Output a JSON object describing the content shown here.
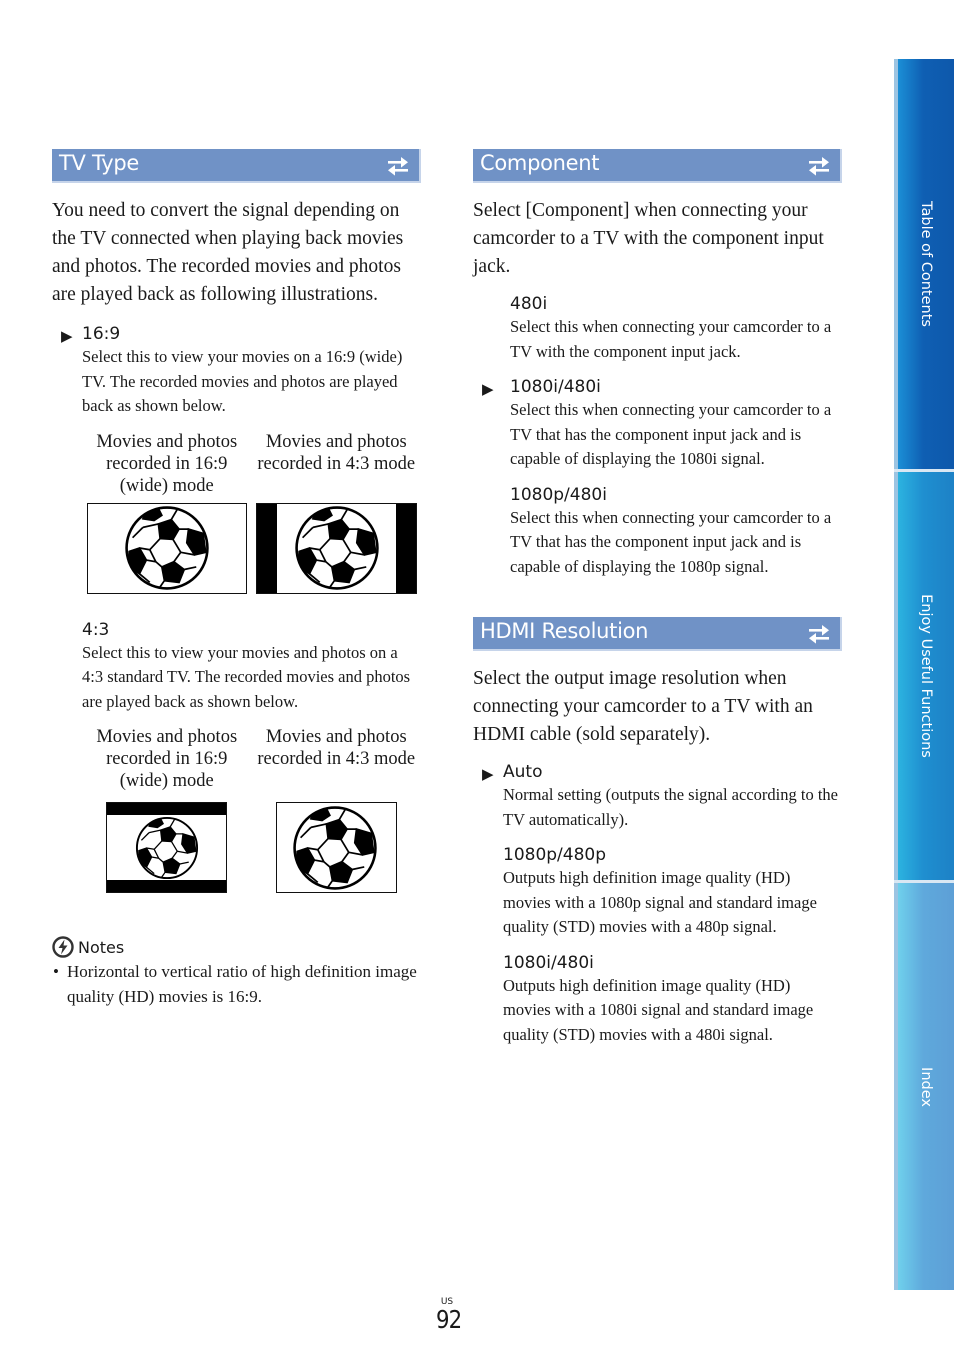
{
  "left": {
    "header": {
      "title": "TV Type",
      "jump_icon": "return-arrows-icon"
    },
    "intro": "You need to convert the signal depending on the TV connected when playing back movies and photos. The recorded movies and photos are played back as following illustrations.",
    "options": [
      {
        "label": "16:9",
        "default": true,
        "desc": "Select this to view your movies on a 16:9 (wide) TV. The recorded movies and photos are played back as shown below.",
        "captions": [
          "Movies and photos recorded in 16:9 (wide) mode",
          "Movies and photos recorded in 4:3 mode"
        ]
      },
      {
        "label": "4:3",
        "default": false,
        "desc": "Select this to view your movies and photos on a 4:3 standard TV. The recorded movies and photos are played back as shown below.",
        "captions": [
          "Movies and photos recorded in 16:9 (wide) mode",
          "Movies and photos recorded in 4:3 mode"
        ]
      }
    ],
    "notes": {
      "title": "Notes",
      "items": [
        "Horizontal to vertical ratio of high definition image quality (HD) movies is 16:9."
      ]
    }
  },
  "right": {
    "component": {
      "header": {
        "title": "Component",
        "jump_icon": "return-arrows-icon"
      },
      "intro": "Select [Component] when connecting your camcorder to a TV with the component input jack.",
      "options": [
        {
          "label": "480i",
          "default": false,
          "desc": "Select this when connecting your camcorder to a TV with the component input jack."
        },
        {
          "label": "1080i/480i",
          "default": true,
          "desc": "Select this when connecting your camcorder to a TV that has the component input jack and is capable of displaying the 1080i signal."
        },
        {
          "label": "1080p/480i",
          "default": false,
          "desc": "Select this when connecting your camcorder to a TV that has the component input jack and is capable of displaying the 1080p signal."
        }
      ]
    },
    "hdmi": {
      "header": {
        "title": "HDMI Resolution",
        "jump_icon": "return-arrows-icon"
      },
      "intro": "Select the output image resolution when connecting your camcorder to a TV with an HDMI cable (sold separately).",
      "options": [
        {
          "label": "Auto",
          "default": true,
          "desc": "Normal setting (outputs the signal according to the TV automatically)."
        },
        {
          "label": "1080p/480p",
          "default": false,
          "desc": "Outputs high definition image quality (HD) movies with a 1080p signal and standard image quality (STD) movies with a 480p signal."
        },
        {
          "label": "1080i/480i",
          "default": false,
          "desc": "Outputs high definition image quality (HD) movies with a 1080i signal and standard image quality (STD) movies with a 480i signal."
        }
      ]
    }
  },
  "default_marker": "▶",
  "bullet": "•",
  "side_tabs": [
    "Table of Contents",
    "Enjoy Useful Functions",
    "Index"
  ],
  "page": {
    "region": "US",
    "number": "92"
  },
  "colors": {
    "header_bg": "#7092c6",
    "tab_toc": "#0f5fb3",
    "tab_functions": "#1f8fd0",
    "tab_index": "#5fa9dc"
  }
}
